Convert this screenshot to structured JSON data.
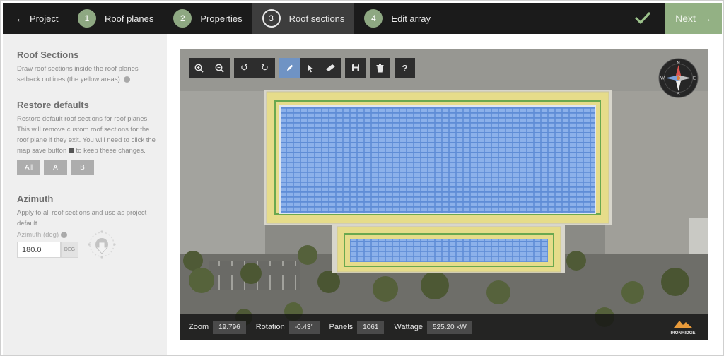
{
  "topbar": {
    "back_label": "Project",
    "steps": [
      {
        "num": "1",
        "label": "Roof planes"
      },
      {
        "num": "2",
        "label": "Properties"
      },
      {
        "num": "3",
        "label": "Roof sections"
      },
      {
        "num": "4",
        "label": "Edit array"
      }
    ],
    "active_step": 3,
    "next_label": "Next"
  },
  "sidebar": {
    "roof_sections": {
      "title": "Roof Sections",
      "text": "Draw roof sections inside the roof planes' setback outlines (the yellow areas)."
    },
    "restore": {
      "title": "Restore defaults",
      "text_before": "Restore default roof sections for roof planes. This will remove custom roof sections for the roof plane if they exit. You will need to click the map save button",
      "text_after": "to keep these changes.",
      "buttons": [
        "All",
        "A",
        "B"
      ]
    },
    "azimuth": {
      "title": "Azimuth",
      "text": "Apply to all roof sections and use as project default",
      "field_label": "Azimuth (deg)",
      "value": "180.0",
      "unit": "DEG"
    }
  },
  "map": {
    "toolbar": {
      "zoom_in_icon": "zoom-in-icon",
      "zoom_out_icon": "zoom-out-icon",
      "active_tool": "pencil"
    },
    "compass": {
      "n": "N",
      "s": "S",
      "e": "E",
      "w": "W"
    },
    "status": {
      "zoom_label": "Zoom",
      "zoom": "19.796",
      "rotation_label": "Rotation",
      "rotation": "-0.43°",
      "panels_label": "Panels",
      "panels": "1061",
      "wattage_label": "Wattage",
      "wattage": "525.20 kW"
    },
    "brand": "IRONRIDGE"
  },
  "colors": {
    "topbar": "#1b1b1b",
    "step_done": "#8ea882",
    "next_button": "#93b184",
    "panel_blue": "#7fa6e0",
    "setback_yellow": "#e6dc8a",
    "roof_green": "#6aa84f"
  }
}
